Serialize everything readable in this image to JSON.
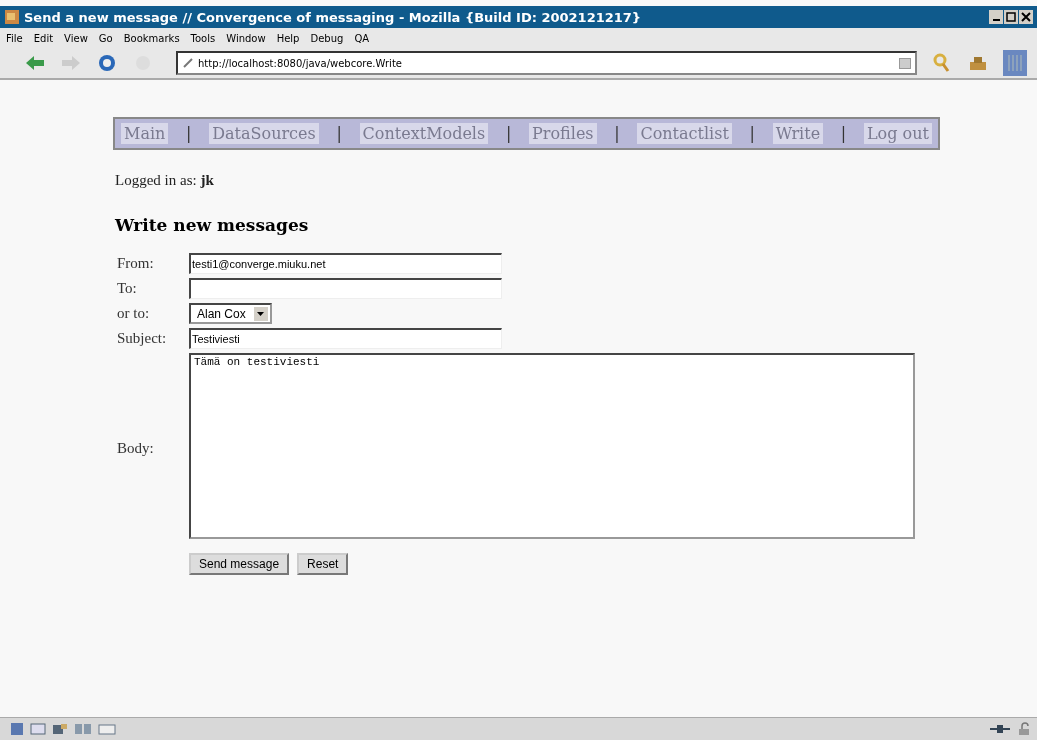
{
  "window": {
    "title": "Send a new message // Convergence of messaging - Mozilla {Build ID: 2002121217}"
  },
  "menu": [
    "File",
    "Edit",
    "View",
    "Go",
    "Bookmarks",
    "Tools",
    "Window",
    "Help",
    "Debug",
    "QA"
  ],
  "toolbar": {
    "url": "http://localhost:8080/java/webcore.Write"
  },
  "nav": [
    {
      "label": "Main",
      "divider": "|"
    },
    {
      "label": "DataSources",
      "divider": "|"
    },
    {
      "label": "ContextModels",
      "divider": "|"
    },
    {
      "label": "Profiles",
      "divider": "|"
    },
    {
      "label": "Contactlist",
      "divider": "|"
    },
    {
      "label": "Write",
      "divider": "|"
    },
    {
      "label": "Log out"
    }
  ],
  "login": {
    "label": "Logged in as:",
    "user": "jk"
  },
  "heading": "Write new messages",
  "form": [
    {
      "kind": "text",
      "label": "From:",
      "value": "testi1@converge.miuku.net"
    },
    {
      "kind": "text",
      "label": "To:"
    },
    {
      "kind": "select",
      "label": "or to:",
      "value": "Alan Cox"
    },
    {
      "kind": "text",
      "label": "Subject:",
      "value": "Testiviesti"
    },
    {
      "kind": "textarea",
      "label": "Body:",
      "value": "Tämä on testiviesti"
    }
  ],
  "buttons": [
    "Send message",
    "Reset"
  ]
}
